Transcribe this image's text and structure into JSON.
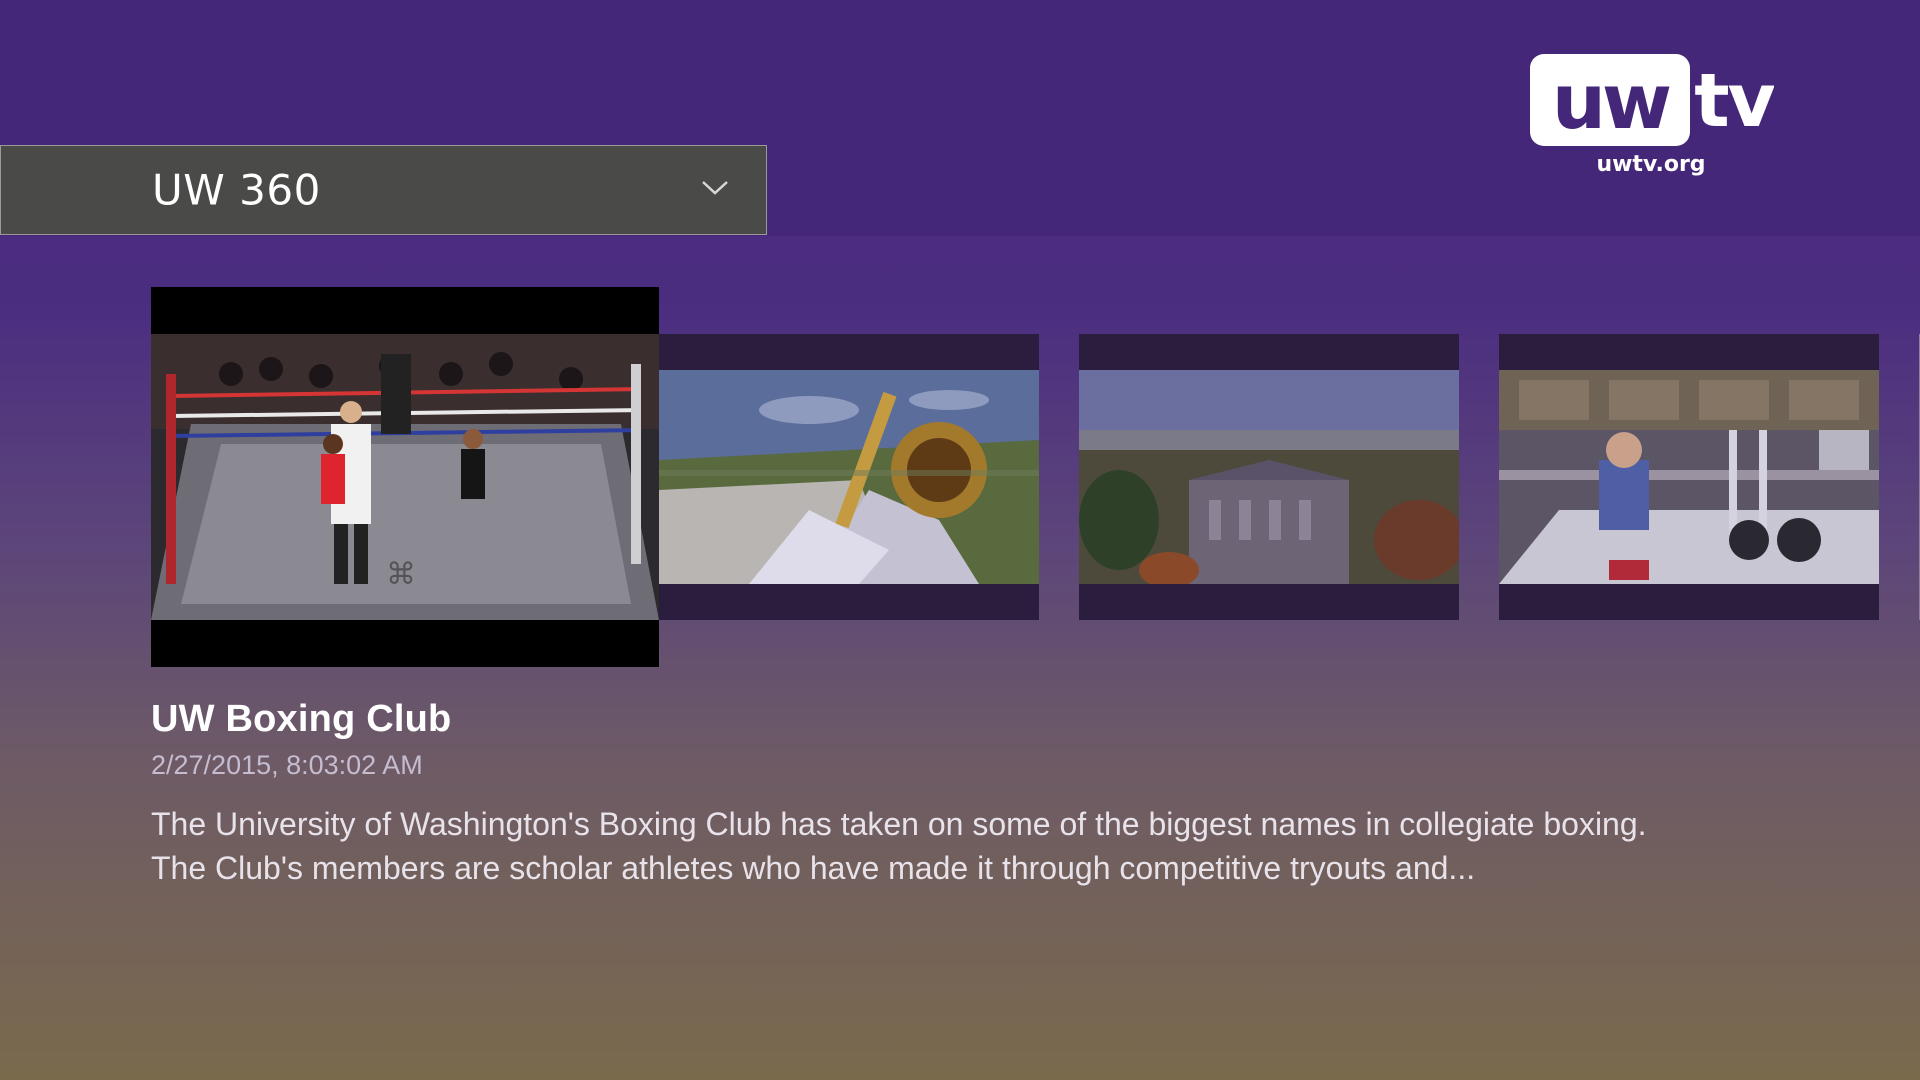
{
  "header": {
    "category_selector": {
      "selected": "UW 360"
    },
    "logo": {
      "text_left": "uw",
      "text_right": "tv",
      "url": "uwtv.org"
    }
  },
  "carousel": {
    "items": [
      {
        "focused": true,
        "thumbnail": "boxing-ring-referee-raising-hand"
      },
      {
        "focused": false,
        "thumbnail": "marching-band-trombone-stadium"
      },
      {
        "focused": false,
        "thumbnail": "aerial-campus-autumn"
      },
      {
        "focused": false,
        "thumbnail": "lab-researcher-microscope"
      }
    ]
  },
  "details": {
    "title": "UW Boxing Club",
    "date": "2/27/2015, 8:03:02 AM",
    "description": "The University of Washington's Boxing Club has taken on some of the biggest names in collegiate boxing. The Club's members are scholar athletes who have made it through competitive tryouts and..."
  },
  "colors": {
    "top_bar": "#45277a",
    "selector_bg": "#4a4a48",
    "gradient_bottom": "#7a6a4c"
  }
}
